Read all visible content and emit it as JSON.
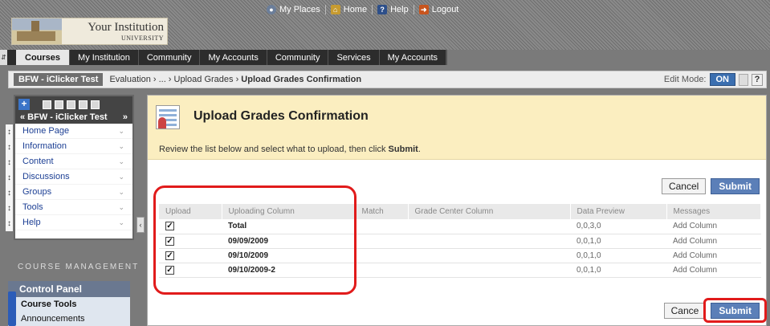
{
  "header": {
    "logo_name": "Your Institution",
    "logo_sub": "UNIVERSITY",
    "links": [
      {
        "label": "My Places",
        "icon": "people-icon"
      },
      {
        "label": "Home",
        "icon": "home-icon"
      },
      {
        "label": "Help",
        "icon": "help-icon"
      },
      {
        "label": "Logout",
        "icon": "logout-icon"
      }
    ]
  },
  "tabs": [
    "Courses",
    "My Institution",
    "Community",
    "My Accounts",
    "Community",
    "Services",
    "My Accounts"
  ],
  "breadcrumb": {
    "course": "BFW - iClicker Test",
    "trail": "Evaluation › ... › Upload Grades › ",
    "current": "Upload Grades Confirmation",
    "edit_mode_label": "Edit Mode:",
    "edit_mode_value": "ON",
    "help": "?"
  },
  "course_menu": {
    "title": "« BFW - iClicker Test",
    "title_arrow": "»",
    "items": [
      "Home Page",
      "Information",
      "Content",
      "Discussions",
      "Groups",
      "Tools",
      "Help"
    ]
  },
  "course_management": {
    "label": "COURSE MANAGEMENT",
    "panel_title": "Control Panel",
    "items": [
      "Course Tools",
      "Announcements"
    ]
  },
  "page": {
    "title": "Upload Grades Confirmation",
    "instructions_prefix": "Review the list below and select what to upload, then click ",
    "instructions_bold": "Submit",
    "instructions_suffix": ".",
    "cancel_label": "Cancel",
    "submit_label": "Submit",
    "cancel_label_bottom": "Cance"
  },
  "table": {
    "columns": [
      "Upload",
      "Uploading Column",
      "Match",
      "Grade Center Column",
      "Data Preview",
      "Messages"
    ],
    "rows": [
      {
        "checked": true,
        "column": "Total",
        "match": "",
        "grade_center": "",
        "preview": "0,0,3,0",
        "message": "Add Column"
      },
      {
        "checked": true,
        "column": "09/09/2009",
        "match": "",
        "grade_center": "",
        "preview": "0,0,1,0",
        "message": "Add Column"
      },
      {
        "checked": true,
        "column": "09/10/2009",
        "match": "",
        "grade_center": "",
        "preview": "0,0,1,0",
        "message": "Add Column"
      },
      {
        "checked": true,
        "column": "09/10/2009-2",
        "match": "",
        "grade_center": "",
        "preview": "0,0,1,0",
        "message": "Add Column"
      }
    ]
  },
  "colors": {
    "highlight": "#e11b1b",
    "submit": "#5b7fb8",
    "header_band": "#fbeec0"
  }
}
